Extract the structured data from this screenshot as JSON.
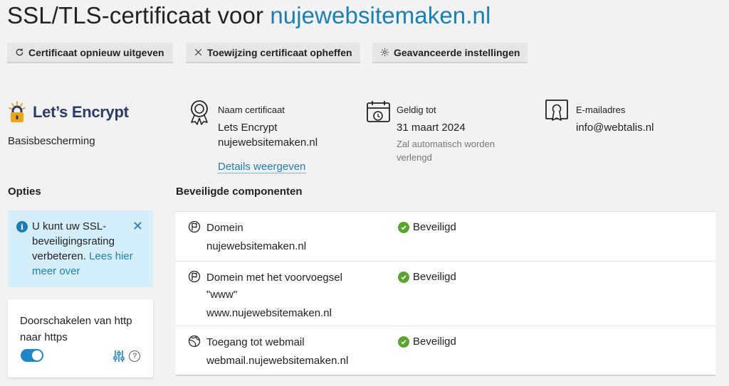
{
  "page": {
    "title_prefix": "SSL/TLS-certificaat voor ",
    "title_domain": "nujewebsitemaken.nl"
  },
  "toolbar": {
    "reissue_label": "Certificaat opnieuw uitgeven",
    "unassign_label": "Toewijzing certificaat opheffen",
    "advanced_label": "Geavanceerde instellingen"
  },
  "provider": {
    "logo_text": "Let’s Encrypt",
    "level": "Basisbescherming"
  },
  "certificate": {
    "name_label": "Naam certificaat",
    "name_line1": "Lets Encrypt",
    "name_line2": "nujewebsitemaken.nl",
    "details_link": "Details weergeven",
    "valid_label": "Geldig tot",
    "valid_date": "31 maart 2024",
    "renew_note": "Zal automatisch worden verlengd",
    "email_label": "E-mailadres",
    "email_value": "info@webtalis.nl"
  },
  "options": {
    "heading": "Opties",
    "notice_text": "U kunt uw SSL-beveiligingsrating verbeteren.",
    "notice_link": "Lees hier meer over",
    "redirect_label": "Doorschakelen van http naar https",
    "redirect_enabled": true
  },
  "components": {
    "heading": "Beveiligde componenten",
    "rows": [
      {
        "name": "Domein",
        "host": "nujewebsitemaken.nl",
        "status": "Beveiligd"
      },
      {
        "name": "Domein met het voorvoegsel \"www\"",
        "host": "www.nujewebsitemaken.nl",
        "status": "Beveiligd"
      },
      {
        "name": "Toegang tot webmail",
        "host": "webmail.nujewebsitemaken.nl",
        "status": "Beveiligd"
      }
    ]
  },
  "colors": {
    "accent": "#1a7fb4",
    "notice_bg": "#d4eefa",
    "success": "#5aa52f",
    "toggle_on": "#1e87c8"
  }
}
